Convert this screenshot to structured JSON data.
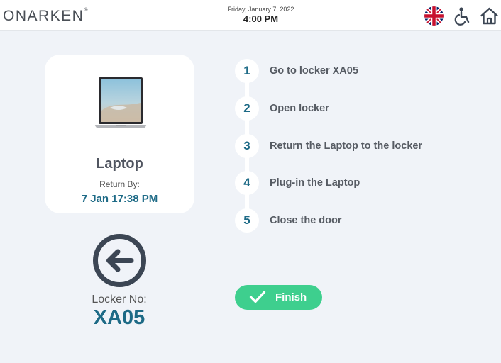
{
  "header": {
    "logo_text": "ONARKEN",
    "logo_mark": "®",
    "date": "Friday, January 7, 2022",
    "time": "4:00 PM",
    "icons": [
      "uk-flag-icon",
      "accessibility-icon",
      "home-icon"
    ]
  },
  "item": {
    "name": "Laptop",
    "return_label": "Return By:",
    "return_date": "7 Jan 17:38 PM"
  },
  "locker": {
    "label": "Locker No:",
    "number": "XA05"
  },
  "steps": [
    {
      "num": "1",
      "text": "Go to locker XA05"
    },
    {
      "num": "2",
      "text": "Open locker"
    },
    {
      "num": "3",
      "text": "Return the Laptop to the locker"
    },
    {
      "num": "4",
      "text": "Plug-in the Laptop"
    },
    {
      "num": "5",
      "text": "Close the door"
    }
  ],
  "finish": {
    "label": "Finish"
  },
  "colors": {
    "accent": "#1d6a86",
    "finish": "#3ecf8e",
    "background": "#f0f3f8",
    "icon_dark": "#3c4654"
  }
}
